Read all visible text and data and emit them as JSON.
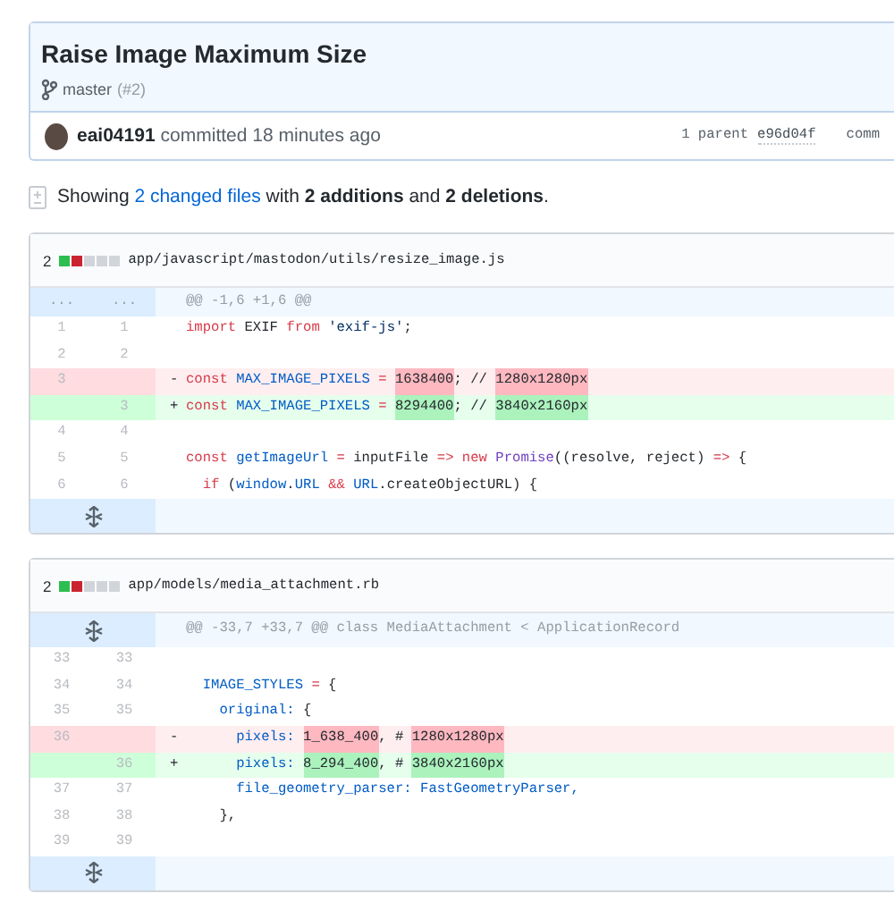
{
  "commit": {
    "title": "Raise Image Maximum Size",
    "branch": "master",
    "pr": "(#2)",
    "author": "eai04191",
    "action": "committed 18 minutes ago",
    "parents": "1 parent",
    "parent_sha": "e96d04f",
    "cut_label": "comm"
  },
  "summary": [
    {
      "text": "Showing ",
      "kind": "plain"
    },
    {
      "text": "2 changed files",
      "kind": "link"
    },
    {
      "text": " with ",
      "kind": "plain"
    },
    {
      "text": "2 additions",
      "kind": "bold"
    },
    {
      "text": " and ",
      "kind": "plain"
    },
    {
      "text": "2 deletions",
      "kind": "bold"
    },
    {
      "text": ".",
      "kind": "plain"
    }
  ],
  "files": [
    {
      "count": "2",
      "stat_blocks": [
        {
          "kind": "add"
        },
        {
          "kind": "del"
        },
        {
          "kind": "neutral"
        },
        {
          "kind": "neutral"
        },
        {
          "kind": "neutral"
        }
      ],
      "path": "app/javascript/mastodon/utils/resize_image.js",
      "lines": [
        {
          "kind": "hunk",
          "old": "...",
          "new": "...",
          "segments": [
            {
              "text": "@@ -1,6 +1,6 @@",
              "kind": "p"
            }
          ]
        },
        {
          "kind": "context",
          "old": "1",
          "new": "1",
          "segments": [
            {
              "text": "import",
              "kind": "k"
            },
            {
              "text": " EXIF ",
              "kind": "p"
            },
            {
              "text": "from ",
              "kind": "k"
            },
            {
              "text": "'exif-js'",
              "kind": "s"
            },
            {
              "text": ";",
              "kind": "p"
            }
          ]
        },
        {
          "kind": "context",
          "old": "2",
          "new": "2"
        },
        {
          "kind": "del",
          "old": "3",
          "sign": "-",
          "segments": [
            {
              "text": "const ",
              "kind": "k"
            },
            {
              "text": "MAX_IMAGE_PIXELS ",
              "kind": "c"
            },
            {
              "text": "= ",
              "kind": "k"
            },
            {
              "text": "1638400",
              "kind": "d"
            },
            {
              "text": "; // ",
              "kind": "p"
            },
            {
              "text": "1280x1280px",
              "kind": "d"
            }
          ]
        },
        {
          "kind": "add",
          "new": "3",
          "sign": "+",
          "segments": [
            {
              "text": "const ",
              "kind": "k"
            },
            {
              "text": "MAX_IMAGE_PIXELS ",
              "kind": "c"
            },
            {
              "text": "= ",
              "kind": "k"
            },
            {
              "text": "8294400",
              "kind": "a"
            },
            {
              "text": "; // ",
              "kind": "p"
            },
            {
              "text": "3840x2160px",
              "kind": "a"
            }
          ]
        },
        {
          "kind": "context",
          "old": "4",
          "new": "4"
        },
        {
          "kind": "context",
          "old": "5",
          "new": "5",
          "segments": [
            {
              "text": "const ",
              "kind": "k"
            },
            {
              "text": "getImageUrl ",
              "kind": "c"
            },
            {
              "text": "=",
              "kind": "k"
            },
            {
              "text": " inputFile ",
              "kind": "p"
            },
            {
              "text": "=> new ",
              "kind": "k"
            },
            {
              "text": "Promise",
              "kind": "e"
            },
            {
              "text": "((resolve, reject) ",
              "kind": "p"
            },
            {
              "text": "=>",
              "kind": "k"
            },
            {
              "text": " {",
              "kind": "p"
            }
          ]
        },
        {
          "kind": "context",
          "old": "6",
          "new": "6",
          "segments": [
            {
              "text": "  if",
              "kind": "k"
            },
            {
              "text": " (",
              "kind": "p"
            },
            {
              "text": "window",
              "kind": "c"
            },
            {
              "text": ".",
              "kind": "p"
            },
            {
              "text": "URL ",
              "kind": "c"
            },
            {
              "text": "&& ",
              "kind": "k"
            },
            {
              "text": "URL",
              "kind": "c"
            },
            {
              "text": ".createObjectURL) {",
              "kind": "p"
            }
          ]
        },
        {
          "kind": "expand"
        }
      ]
    },
    {
      "count": "2",
      "stat_blocks": [
        {
          "kind": "add"
        },
        {
          "kind": "del"
        },
        {
          "kind": "neutral"
        },
        {
          "kind": "neutral"
        },
        {
          "kind": "neutral"
        }
      ],
      "path": "app/models/media_attachment.rb",
      "lines": [
        {
          "kind": "expand",
          "segments": [
            {
              "text": "@@ -33,7 +33,7 @@ class MediaAttachment < ApplicationRecord",
              "kind": "p"
            }
          ]
        },
        {
          "kind": "context",
          "old": "33",
          "new": "33"
        },
        {
          "kind": "context",
          "old": "34",
          "new": "34",
          "segments": [
            {
              "text": "  IMAGE_STYLES ",
              "kind": "c"
            },
            {
              "text": "=",
              "kind": "k"
            },
            {
              "text": " {",
              "kind": "p"
            }
          ]
        },
        {
          "kind": "context",
          "old": "35",
          "new": "35",
          "segments": [
            {
              "text": "    original:",
              "kind": "c"
            },
            {
              "text": " {",
              "kind": "p"
            }
          ]
        },
        {
          "kind": "del",
          "old": "36",
          "sign": "-",
          "segments": [
            {
              "text": "      pixels: ",
              "kind": "c"
            },
            {
              "text": "1_638_400",
              "kind": "d"
            },
            {
              "text": ", # ",
              "kind": "p"
            },
            {
              "text": "1280x1280px",
              "kind": "d"
            }
          ]
        },
        {
          "kind": "add",
          "new": "36",
          "sign": "+",
          "segments": [
            {
              "text": "      pixels: ",
              "kind": "c"
            },
            {
              "text": "8_294_400",
              "kind": "a"
            },
            {
              "text": ", # ",
              "kind": "p"
            },
            {
              "text": "3840x2160px",
              "kind": "a"
            }
          ]
        },
        {
          "kind": "context",
          "old": "37",
          "new": "37",
          "segments": [
            {
              "text": "      file_geometry_parser: FastGeometryParser,",
              "kind": "c"
            }
          ]
        },
        {
          "kind": "context",
          "old": "38",
          "new": "38",
          "segments": [
            {
              "text": "    },",
              "kind": "p"
            }
          ]
        },
        {
          "kind": "context",
          "old": "39",
          "new": "39"
        },
        {
          "kind": "expand"
        }
      ]
    }
  ]
}
